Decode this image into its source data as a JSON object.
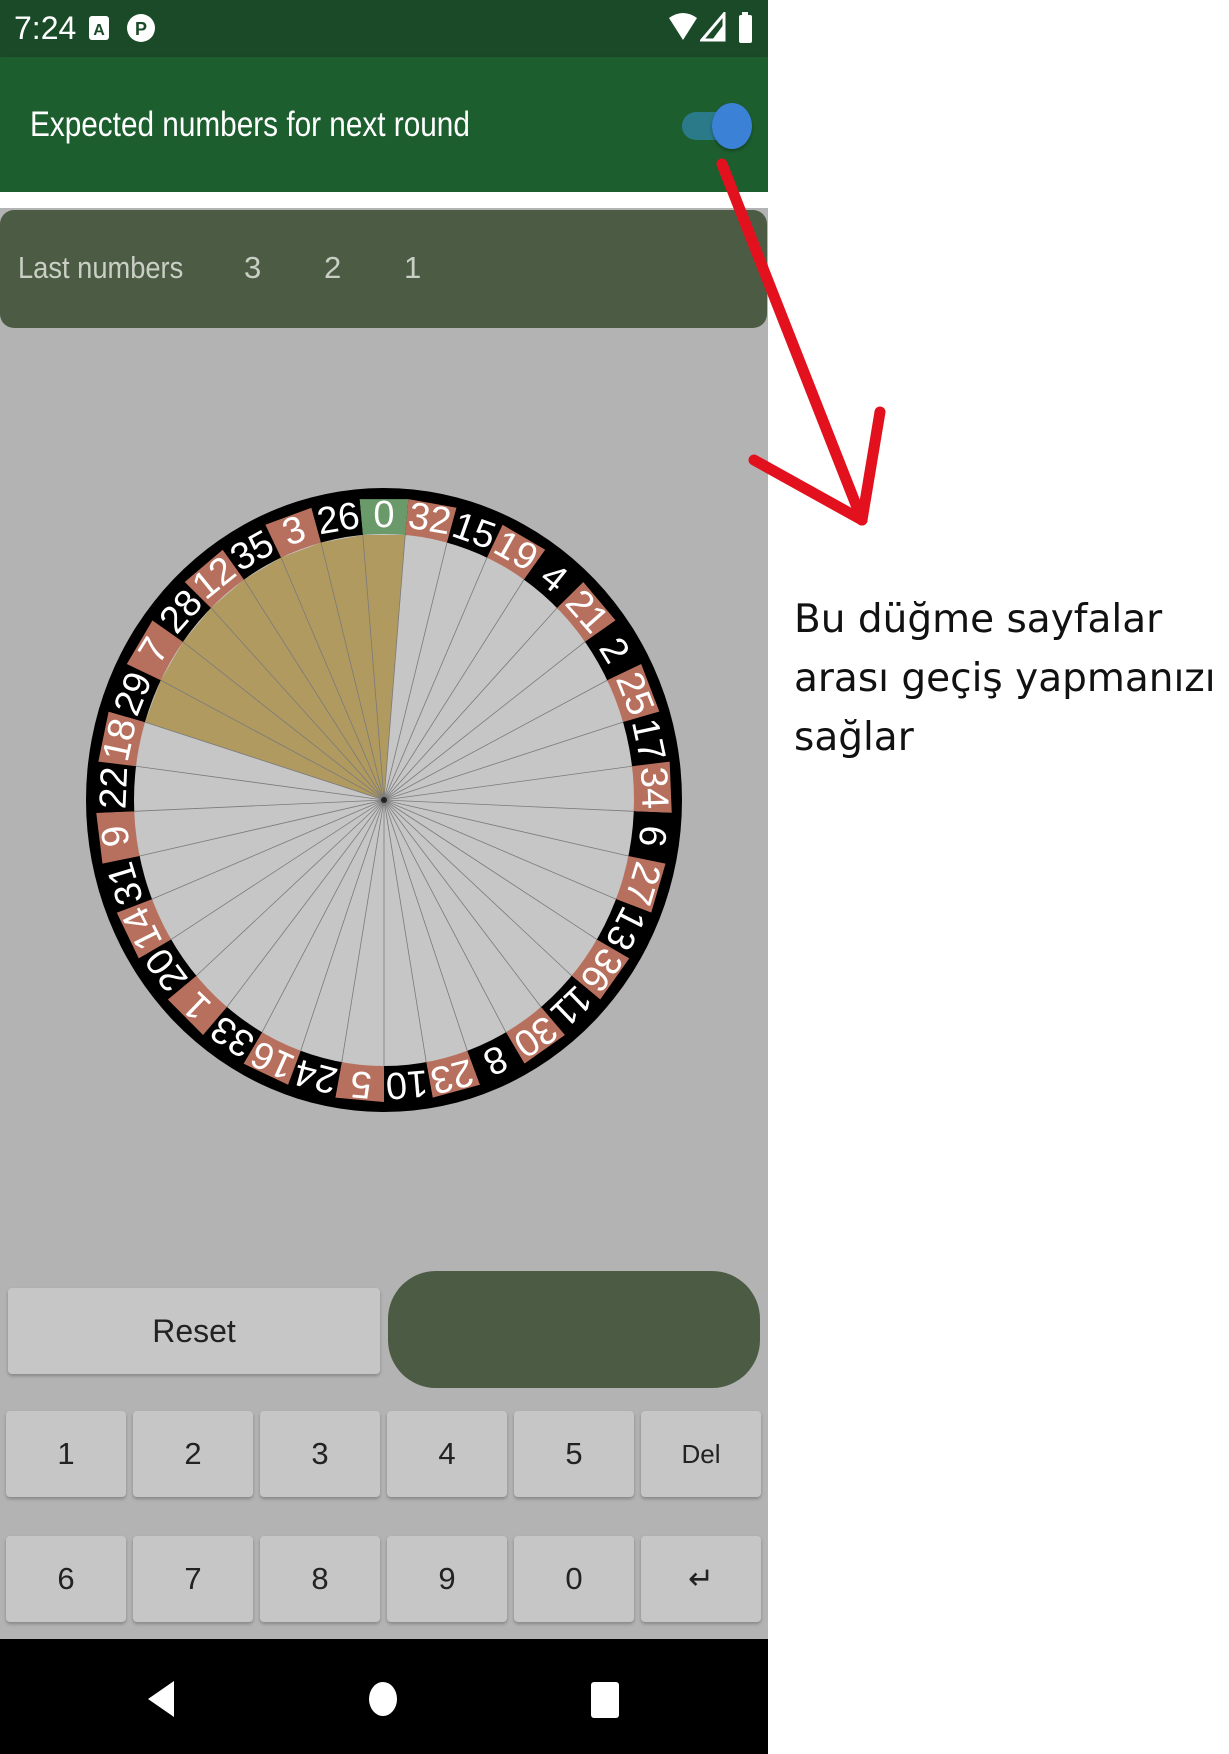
{
  "status_bar": {
    "time": "7:24",
    "icons": [
      "a-badge-icon",
      "p-badge-icon",
      "wifi-icon",
      "signal-icon",
      "battery-icon"
    ]
  },
  "app_bar": {
    "title": "Expected numbers for next round",
    "toggle": {
      "state": "on",
      "track_color": "#2a7a8a",
      "thumb_color": "#3b82d6"
    }
  },
  "last_numbers": {
    "label": "Last numbers",
    "values": [
      "3",
      "2",
      "1"
    ]
  },
  "wheel": {
    "pockets": [
      "0",
      "32",
      "15",
      "19",
      "4",
      "21",
      "2",
      "25",
      "17",
      "34",
      "6",
      "27",
      "13",
      "36",
      "11",
      "30",
      "8",
      "23",
      "10",
      "5",
      "24",
      "16",
      "33",
      "1",
      "20",
      "14",
      "31",
      "9",
      "22",
      "18",
      "29",
      "7",
      "28",
      "12",
      "35",
      "3",
      "26"
    ],
    "highlighted_pockets": [
      "0",
      "32",
      "15",
      "19",
      "4",
      "21",
      "2",
      "25",
      "17",
      "34",
      "6",
      "27",
      "13",
      "36",
      "11",
      "30",
      "8",
      "23",
      "10",
      "5",
      "24",
      "16",
      "33",
      "1",
      "20",
      "14",
      "31",
      "9",
      "22",
      "18",
      "29",
      "7",
      "28",
      "12",
      "35",
      "3",
      "26"
    ],
    "highlight_indexes_visible": [
      "29",
      "7",
      "28",
      "12",
      "35",
      "3",
      "26",
      "0"
    ],
    "colors": {
      "green": "#6a9a6a",
      "red": "#b8705e",
      "black": "#000000",
      "highlight": "#b09a60",
      "face": "#c6c6c6"
    }
  },
  "controls": {
    "reset_label": "Reset",
    "primary_button_label": ""
  },
  "keypad": {
    "row1": [
      "1",
      "2",
      "3",
      "4",
      "5",
      "Del"
    ],
    "row2": [
      "6",
      "7",
      "8",
      "9",
      "0",
      "↵"
    ]
  },
  "annotation": {
    "text": "Bu düğme sayfalar arası geçiş yapmanızı sağlar"
  }
}
